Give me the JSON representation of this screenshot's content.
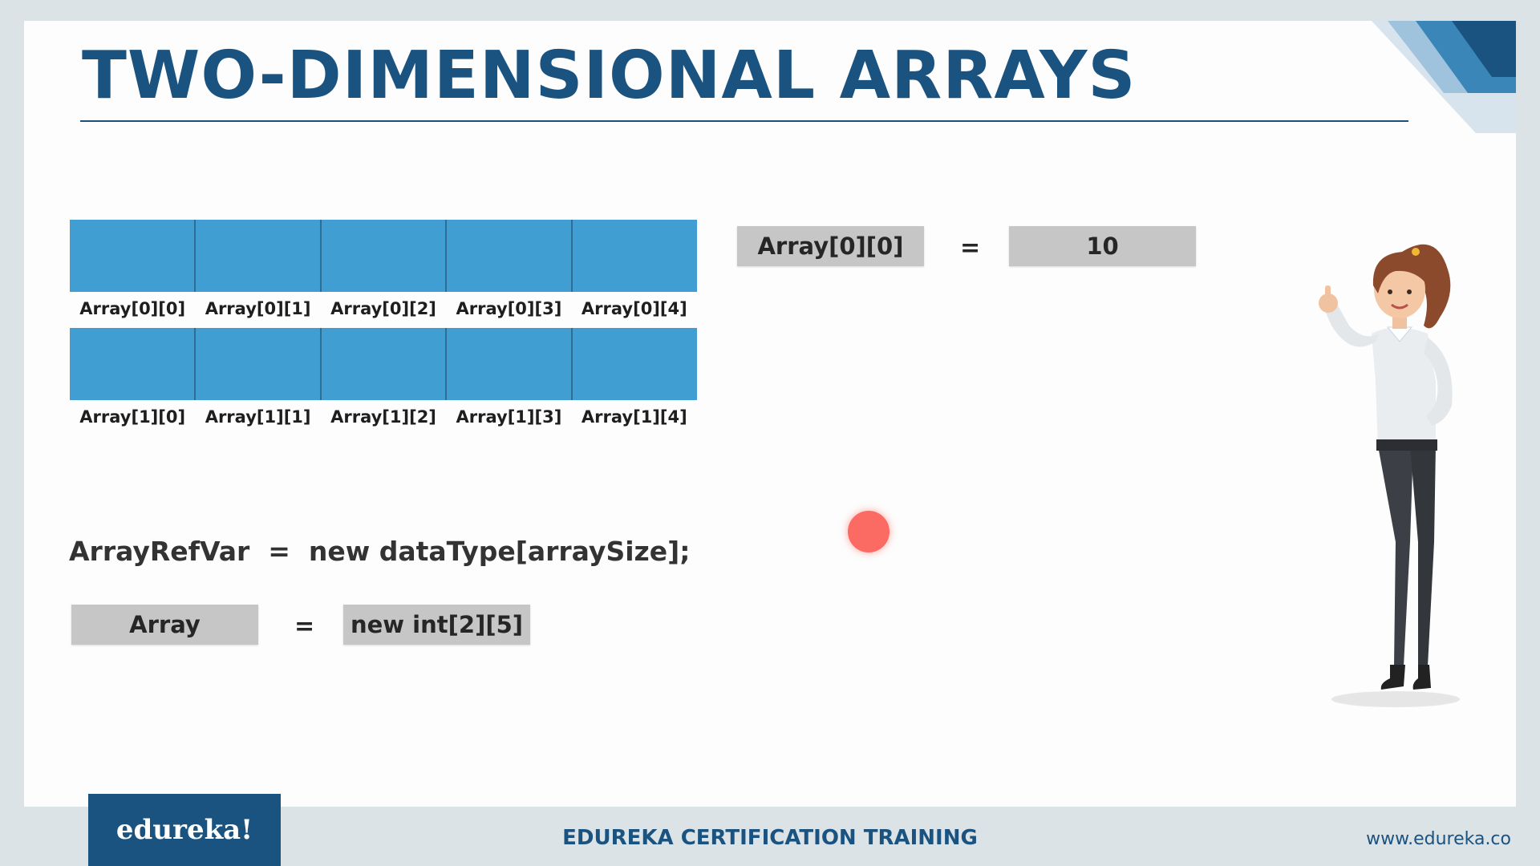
{
  "slide": {
    "title": "TWO-DIMENSIONAL ARRAYS"
  },
  "grid": {
    "rows": [
      {
        "labels": [
          "Array[0][0]",
          "Array[0][1]",
          "Array[0][2]",
          "Array[0][3]",
          "Array[0][4]"
        ]
      },
      {
        "labels": [
          "Array[1][0]",
          "Array[1][1]",
          "Array[1][2]",
          "Array[1][3]",
          "Array[1][4]"
        ]
      }
    ]
  },
  "assignment": {
    "lhs": "Array[0][0]",
    "op": "=",
    "rhs": "10"
  },
  "syntax": {
    "line": "ArrayRefVar  =  new dataType[arraySize];",
    "lhs": "Array",
    "op": "=",
    "rhs": "new int[2][5]"
  },
  "footer": {
    "logo": "edureka!",
    "center": "EDUREKA CERTIFICATION TRAINING",
    "url": "www.edureka.co"
  },
  "colors": {
    "title": "#1a5280",
    "cell": "#419ed3",
    "box": "#c6c6c6",
    "pointer": "#fb6a63"
  }
}
